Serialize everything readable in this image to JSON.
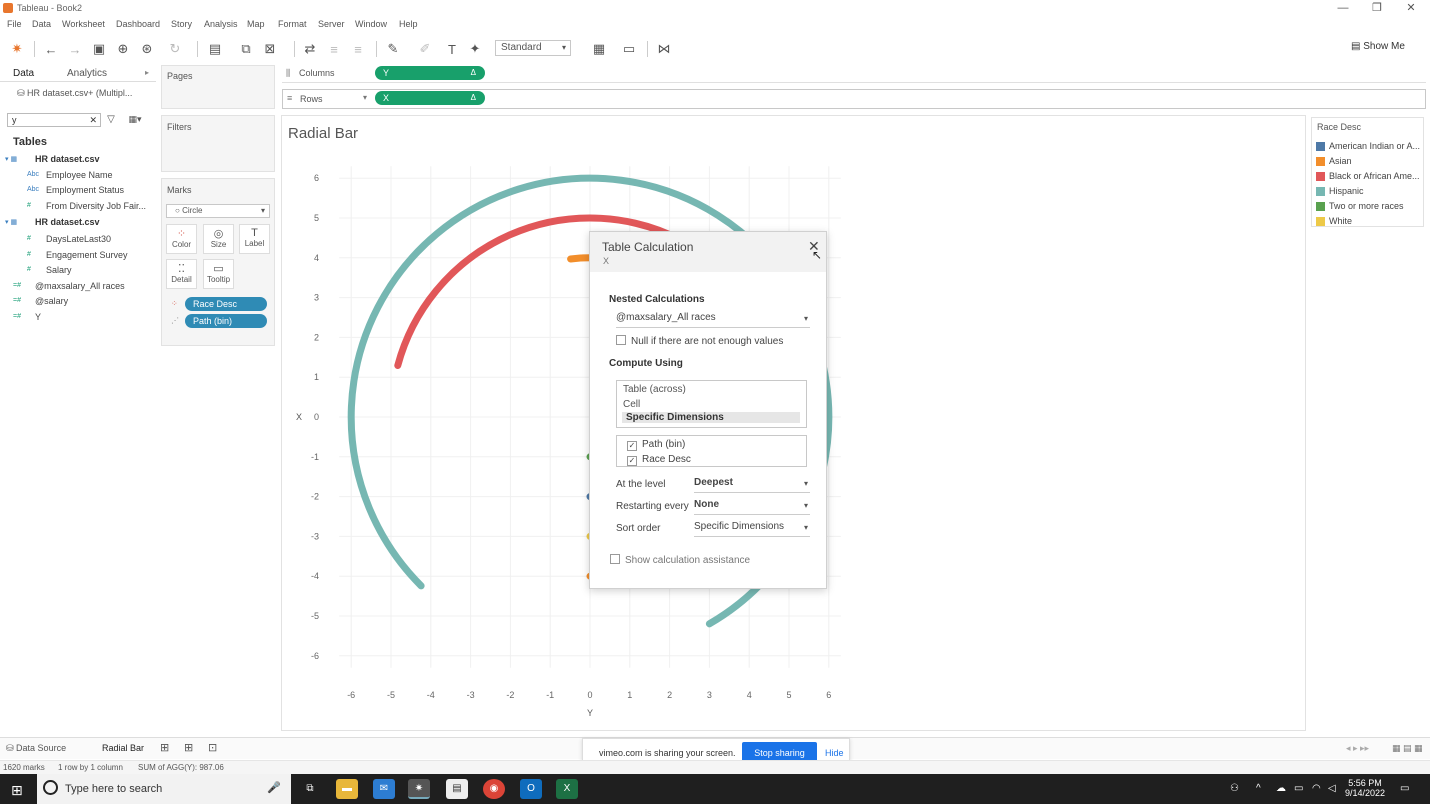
{
  "window": {
    "title": "Tableau - Book2",
    "controls": [
      "—",
      "❐",
      "✕"
    ]
  },
  "menu": [
    "File",
    "Data",
    "Worksheet",
    "Dashboard",
    "Story",
    "Analysis",
    "Map",
    "Format",
    "Server",
    "Window",
    "Help"
  ],
  "toolbar": {
    "fit_select": "Standard",
    "show_me": "Show Me"
  },
  "left_pane": {
    "tabs": [
      "Data",
      "Analytics"
    ],
    "datasource": "HR dataset.csv+ (Multipl...",
    "search_value": "y",
    "tables_heading": "Tables",
    "fields": [
      {
        "label": "HR dataset.csv",
        "kind": "table"
      },
      {
        "label": "Employee Name",
        "kind": "dim",
        "icon": "Abc"
      },
      {
        "label": "Employment Status",
        "kind": "dim",
        "icon": "Abc"
      },
      {
        "label": "From Diversity Job Fair...",
        "kind": "meas",
        "icon": "#"
      },
      {
        "label": "HR dataset.csv",
        "kind": "table"
      },
      {
        "label": "DaysLateLast30",
        "kind": "meas",
        "icon": "#"
      },
      {
        "label": "Engagement Survey",
        "kind": "meas",
        "icon": "#"
      },
      {
        "label": "Salary",
        "kind": "meas",
        "icon": "#"
      },
      {
        "label": "@maxsalary_All races",
        "kind": "calc",
        "icon": "=#"
      },
      {
        "label": "@salary",
        "kind": "calc",
        "icon": "=#"
      },
      {
        "label": "Y",
        "kind": "calc",
        "icon": "=#"
      }
    ]
  },
  "cards": {
    "pages": "Pages",
    "filters": "Filters",
    "marks": "Marks",
    "mark_type": "Circle",
    "mark_buttons": [
      "Color",
      "Size",
      "Label",
      "Detail",
      "Tooltip"
    ],
    "mark_pills": [
      "Race Desc",
      "Path (bin)"
    ]
  },
  "shelves": {
    "columns_label": "Columns",
    "columns_pill": "Y",
    "rows_label": "Rows",
    "rows_pill": "X",
    "pill_delta": "Δ"
  },
  "sheet": {
    "title": "Radial Bar"
  },
  "legend": {
    "title": "Race Desc",
    "items": [
      {
        "label": "American Indian or A...",
        "color": "#4e79a7"
      },
      {
        "label": "Asian",
        "color": "#f28e2b"
      },
      {
        "label": "Black or African Ame...",
        "color": "#e15759"
      },
      {
        "label": "Hispanic",
        "color": "#76b7b2"
      },
      {
        "label": "Two or more races",
        "color": "#59a14f"
      },
      {
        "label": "White",
        "color": "#edc948"
      }
    ]
  },
  "chart_data": {
    "type": "scatter",
    "xlabel": "Y",
    "ylabel": "X",
    "xlim": [
      -6,
      6
    ],
    "ylim": [
      -6,
      6
    ],
    "x_ticks": [
      -6,
      -5,
      -4,
      -3,
      -2,
      -1,
      0,
      1,
      2,
      3,
      4,
      5,
      6
    ],
    "y_ticks": [
      6,
      5,
      4,
      3,
      2,
      1,
      0,
      -1,
      -2,
      -3,
      -4,
      -5,
      -6
    ],
    "grid": true,
    "series": [
      {
        "name": "Hispanic",
        "radius": 6,
        "arc_start_deg": -60,
        "arc_end_deg": 225,
        "color": "#76b7b2"
      },
      {
        "name": "Black or African Ame...",
        "radius": 5,
        "arc_start_deg": -40,
        "arc_end_deg": 165,
        "color": "#e15759"
      },
      {
        "name": "Asian",
        "radius": 4,
        "arc_start_deg": -90,
        "arc_end_deg": 97,
        "color": "#f28e2b"
      },
      {
        "name": "White",
        "radius": 3,
        "arc_start_deg": -90,
        "arc_end_deg": 78,
        "color": "#edc948"
      },
      {
        "name": "American Indian or A...",
        "radius": 2,
        "arc_start_deg": -90,
        "arc_end_deg": 75,
        "color": "#4e79a7"
      },
      {
        "name": "Two or more races",
        "radius": 1,
        "arc_start_deg": -90,
        "arc_end_deg": 30,
        "color": "#59a14f"
      }
    ]
  },
  "dialog": {
    "title": "Table Calculation",
    "subtitle": "X",
    "close": "✕",
    "nested_heading": "Nested Calculations",
    "nested_value": "@maxsalary_All races",
    "null_option": "Null if there are not enough values",
    "compute_heading": "Compute Using",
    "compute_options": [
      "Table (across)",
      "Cell",
      "Specific Dimensions"
    ],
    "dimensions": [
      "Path (bin)",
      "Race Desc"
    ],
    "at_level_label": "At the level",
    "at_level_value": "Deepest",
    "restart_label": "Restarting every",
    "restart_value": "None",
    "sort_label": "Sort order",
    "sort_value": "Specific Dimensions",
    "assist_label": "Show calculation assistance"
  },
  "bottom_tabs": [
    "Data Source",
    "Radial Bar"
  ],
  "share_bar": {
    "message": "vimeo.com is sharing your screen.",
    "stop": "Stop sharing",
    "hide": "Hide"
  },
  "status": {
    "marks": "1620 marks",
    "dims": "1 row by 1 column",
    "sum": "SUM of AGG(Y): 987.06"
  },
  "taskbar": {
    "search_placeholder": "Type here to search",
    "time": "5:56 PM",
    "date": "9/14/2022"
  }
}
